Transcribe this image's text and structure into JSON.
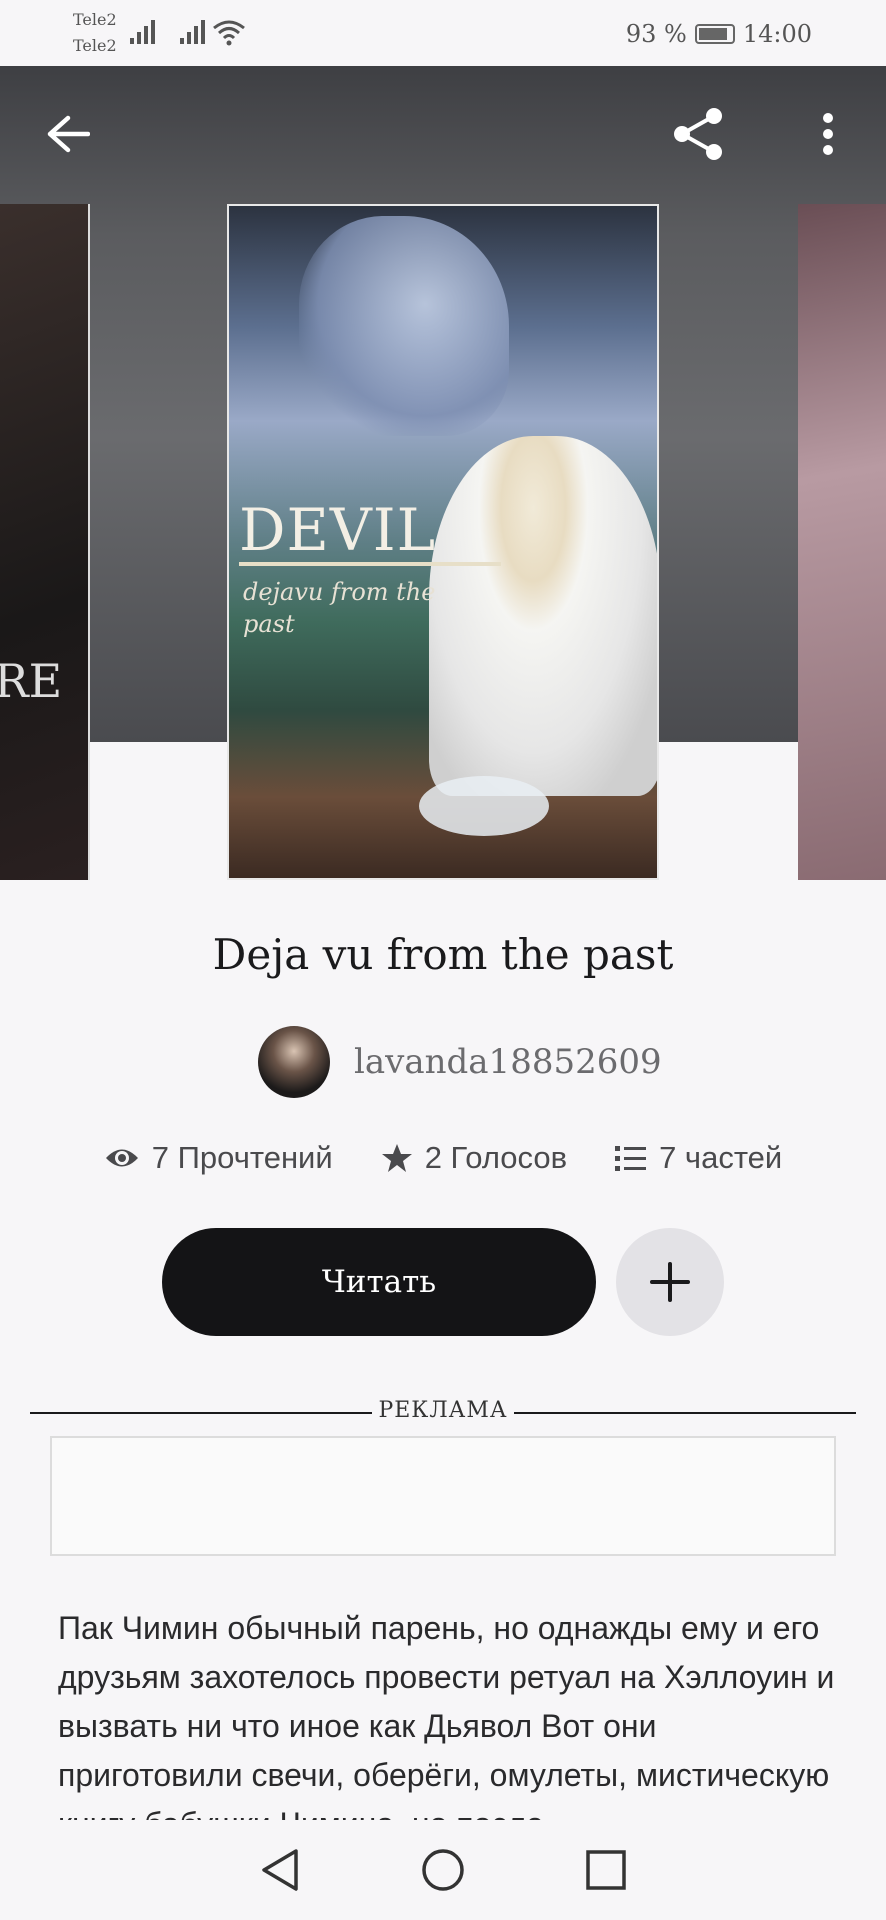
{
  "status_bar": {
    "carrier_1": "Tele2",
    "carrier_2": "Tele2",
    "battery": "93 %",
    "time": "14:00"
  },
  "cover": {
    "title_art": "DEVIL",
    "subtitle_art": "dejavu from the past"
  },
  "side_cover_left_text": "RE",
  "book": {
    "title": "Deja vu from the past",
    "author": "lavanda18852609"
  },
  "stats": {
    "reads": "7 Прочтений",
    "votes": "2 Голосов",
    "parts": "7 частей"
  },
  "buttons": {
    "read": "Читать"
  },
  "ad": {
    "label": "РЕКЛАМА"
  },
  "description": "Пак Чимин обычный парень, но однажды ему и его друзьям захотелось провести ретуал на Хэллоуин и вызвать ни что иное как Дьявол Вот они приготовили свечи, оберёги, омулеты, мистическую книгу бабушки Чимина, но после",
  "icons": {
    "back": "arrow-left-icon",
    "share": "share-icon",
    "more": "more-vertical-icon",
    "eye": "eye-icon",
    "star": "star-icon",
    "list": "list-icon",
    "plus": "plus-icon"
  }
}
